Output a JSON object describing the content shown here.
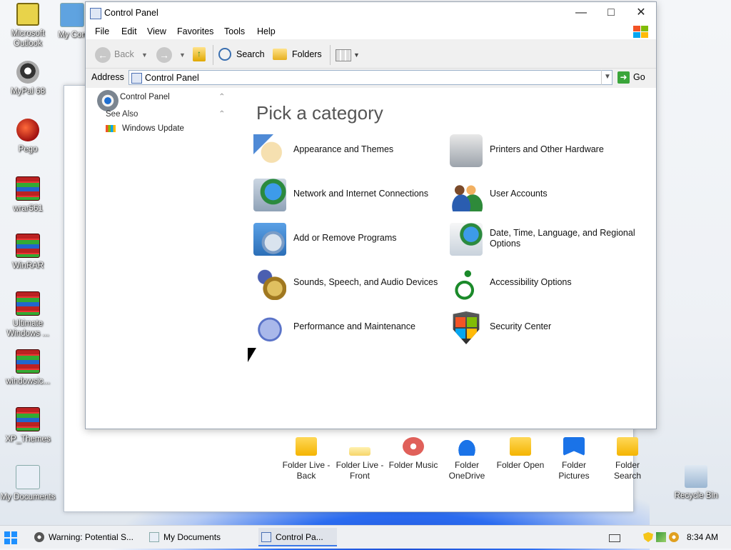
{
  "desktop": {
    "icons_left": [
      {
        "label": "Microsoft Outlook",
        "icon": "outlook-icon"
      },
      {
        "label": "MyPal 68",
        "icon": "mypal-icon"
      },
      {
        "label": "Pego",
        "icon": "pego-icon"
      },
      {
        "label": "wrar561",
        "icon": "winrar-icon"
      },
      {
        "label": "WinRAR",
        "icon": "winrar-icon"
      },
      {
        "label": "Ultimate Windows ...",
        "icon": "winrar-icon"
      },
      {
        "label": "windowsic...",
        "icon": "winrar-icon"
      },
      {
        "label": "XP_Themes",
        "icon": "winrar-icon"
      },
      {
        "label": "My Documents",
        "icon": "documents-icon"
      }
    ],
    "icon_partial": "My Con",
    "recycle_bin": "Recycle Bin"
  },
  "back_window": {
    "folders": [
      {
        "label": "Folder Live - Back",
        "icon": "folder-yellow-icon"
      },
      {
        "label": "Folder Live - Front",
        "icon": "folder-light-icon"
      },
      {
        "label": "Folder Music",
        "icon": "music-icon"
      },
      {
        "label": "Folder OneDrive",
        "icon": "onedrive-icon"
      },
      {
        "label": "Folder Open",
        "icon": "folder-open-icon"
      },
      {
        "label": "Folder Pictures",
        "icon": "pictures-icon"
      },
      {
        "label": "Folder Search",
        "icon": "folder-search-icon"
      }
    ]
  },
  "window": {
    "title": "Control Panel",
    "menu": [
      "File",
      "Edit",
      "View",
      "Favorites",
      "Tools",
      "Help"
    ],
    "toolbar": {
      "back": "Back",
      "search": "Search",
      "folders": "Folders"
    },
    "address_label": "Address",
    "address_value": "Control Panel",
    "go_label": "Go",
    "sidepanel": {
      "title": "Control Panel",
      "see_also": "See Also",
      "windows_update": "Windows Update"
    },
    "heading": "Pick a category",
    "categories_left": [
      {
        "label": "Appearance and Themes",
        "icon": "appearance-icon"
      },
      {
        "label": "Network and Internet Connections",
        "icon": "network-icon"
      },
      {
        "label": "Add or Remove Programs",
        "icon": "programs-icon"
      },
      {
        "label": "Sounds, Speech, and Audio Devices",
        "icon": "sounds-icon"
      },
      {
        "label": "Performance and Maintenance",
        "icon": "performance-icon"
      }
    ],
    "categories_right": [
      {
        "label": "Printers and Other Hardware",
        "icon": "printer-icon"
      },
      {
        "label": "User Accounts",
        "icon": "users-icon"
      },
      {
        "label": "Date, Time, Language, and Regional Options",
        "icon": "datetime-icon"
      },
      {
        "label": "Accessibility Options",
        "icon": "accessibility-icon"
      },
      {
        "label": "Security Center",
        "icon": "security-shield-icon"
      }
    ]
  },
  "taskbar": {
    "tasks": [
      {
        "label": "Warning: Potential S...",
        "icon": "pal-icon"
      },
      {
        "label": "My Documents",
        "icon": "documents-icon"
      },
      {
        "label": "Control Pa...",
        "icon": "control-panel-icon"
      }
    ],
    "clock": "8:34 AM"
  }
}
